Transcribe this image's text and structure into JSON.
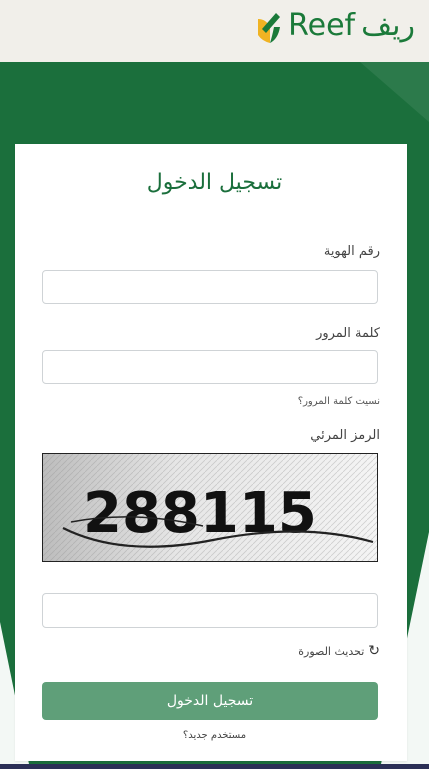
{
  "header": {
    "logo_ar": "ريف",
    "logo_en": "Reef"
  },
  "login": {
    "title": "تسجيل الدخول",
    "id_label": "رقم الهوية",
    "id_placeholder": "",
    "password_label": "كلمة المرور",
    "password_placeholder": "",
    "forgot_password": "نسيت كلمة المرور؟",
    "captcha_label": "الرمز المرئي",
    "captcha_text": "288115",
    "captcha_input_placeholder": "",
    "refresh_image": "تحديث الصورة",
    "login_button": "تسجيل الدخول",
    "new_user": "مستخدم جديد؟"
  },
  "colors": {
    "brand_green": "#1b6f3c",
    "button_green": "#5f9f79",
    "background": "#f2f0eb"
  },
  "icons": {
    "logo_mark": "reef-leaf-logo-icon",
    "refresh": "refresh-icon"
  }
}
